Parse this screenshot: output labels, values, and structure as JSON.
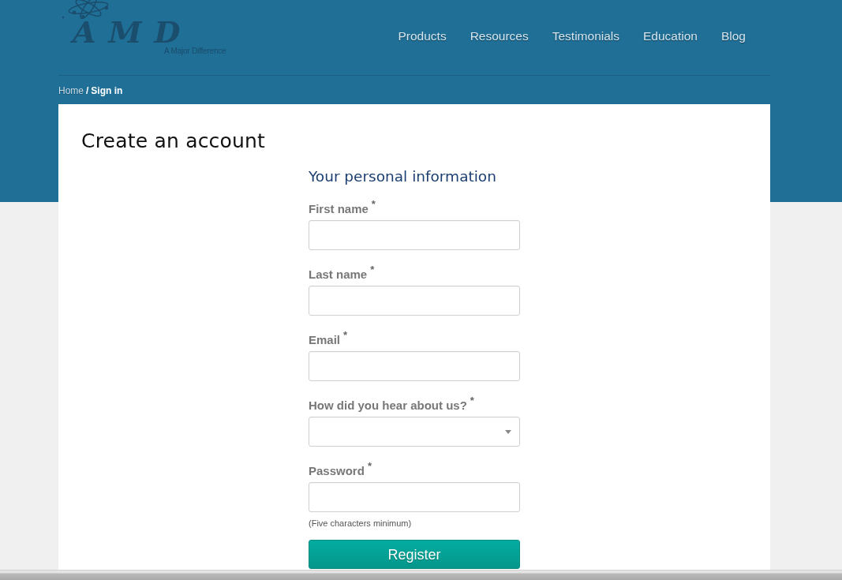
{
  "logo": {
    "wordmark": "AMD",
    "tagline": "A Major Difference"
  },
  "nav": [
    "Products",
    "Resources",
    "Testimonials",
    "Education",
    "Blog"
  ],
  "breadcrumb": {
    "separator": "/",
    "items": [
      {
        "label": "Home",
        "current": false
      },
      {
        "label": "Sign in",
        "current": true
      }
    ]
  },
  "page_title": "Create an account",
  "form": {
    "section_title": "Your personal information",
    "required_mark": "*",
    "fields": [
      {
        "kind": "text",
        "label": "First name",
        "required": true
      },
      {
        "kind": "text",
        "label": "Last name",
        "required": true
      },
      {
        "kind": "text",
        "label": "Email",
        "required": true
      },
      {
        "kind": "select",
        "label": "How did you hear about us?",
        "required": true
      },
      {
        "kind": "password",
        "label": "Password",
        "required": true,
        "hint": "(Five characters minimum)"
      }
    ],
    "submit": "Register"
  }
}
